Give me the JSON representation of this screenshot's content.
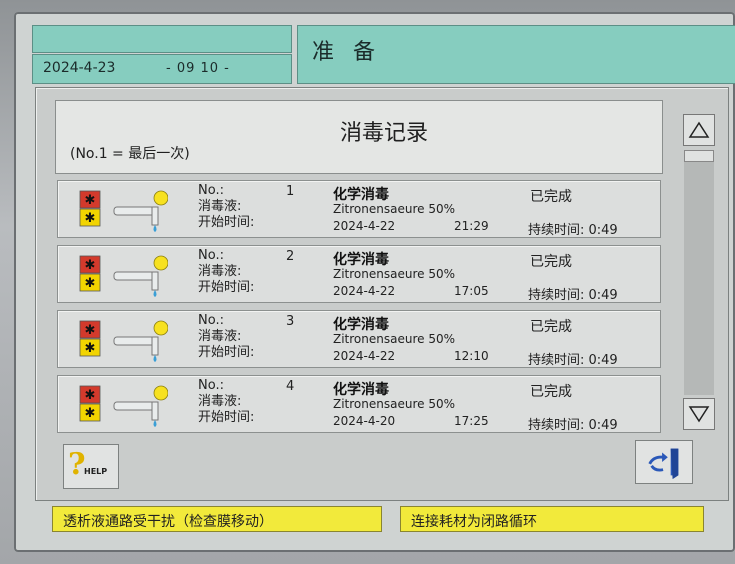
{
  "header": {
    "date": "2024-4-23",
    "time": "- 09 10 -",
    "title": "准 备"
  },
  "records_panel": {
    "title": "消毒记录",
    "subtitle": "(No.1 = 最后一次)",
    "labels": {
      "no": "No.:",
      "fluid": "消毒液:",
      "start": "开始时间:"
    },
    "items": [
      {
        "no": "1",
        "type": "化学消毒",
        "fluid": "Zitronensaeure 50%",
        "date": "2024-4-22",
        "time": "21:29",
        "status": "已完成",
        "duration": "持续时间: 0:49"
      },
      {
        "no": "2",
        "type": "化学消毒",
        "fluid": "Zitronensaeure 50%",
        "date": "2024-4-22",
        "time": "17:05",
        "status": "已完成",
        "duration": "持续时间: 0:49"
      },
      {
        "no": "3",
        "type": "化学消毒",
        "fluid": "Zitronensaeure 50%",
        "date": "2024-4-22",
        "time": "12:10",
        "status": "已完成",
        "duration": "持续时间: 0:49"
      },
      {
        "no": "4",
        "type": "化学消毒",
        "fluid": "Zitronensaeure 50%",
        "date": "2024-4-20",
        "time": "17:25",
        "status": "已完成",
        "duration": "持续时间: 0:49"
      }
    ]
  },
  "buttons": {
    "help_label": "HELP",
    "help_icon": "question-icon",
    "exit_icon": "exit-door-icon",
    "scroll_up_icon": "triangle-up-icon",
    "scroll_down_icon": "triangle-down-icon"
  },
  "status": {
    "left": "透析液通路受干扰（检查膜移动）",
    "right": "连接耗材为闭路循环",
    "color": "#f2ea3b"
  }
}
